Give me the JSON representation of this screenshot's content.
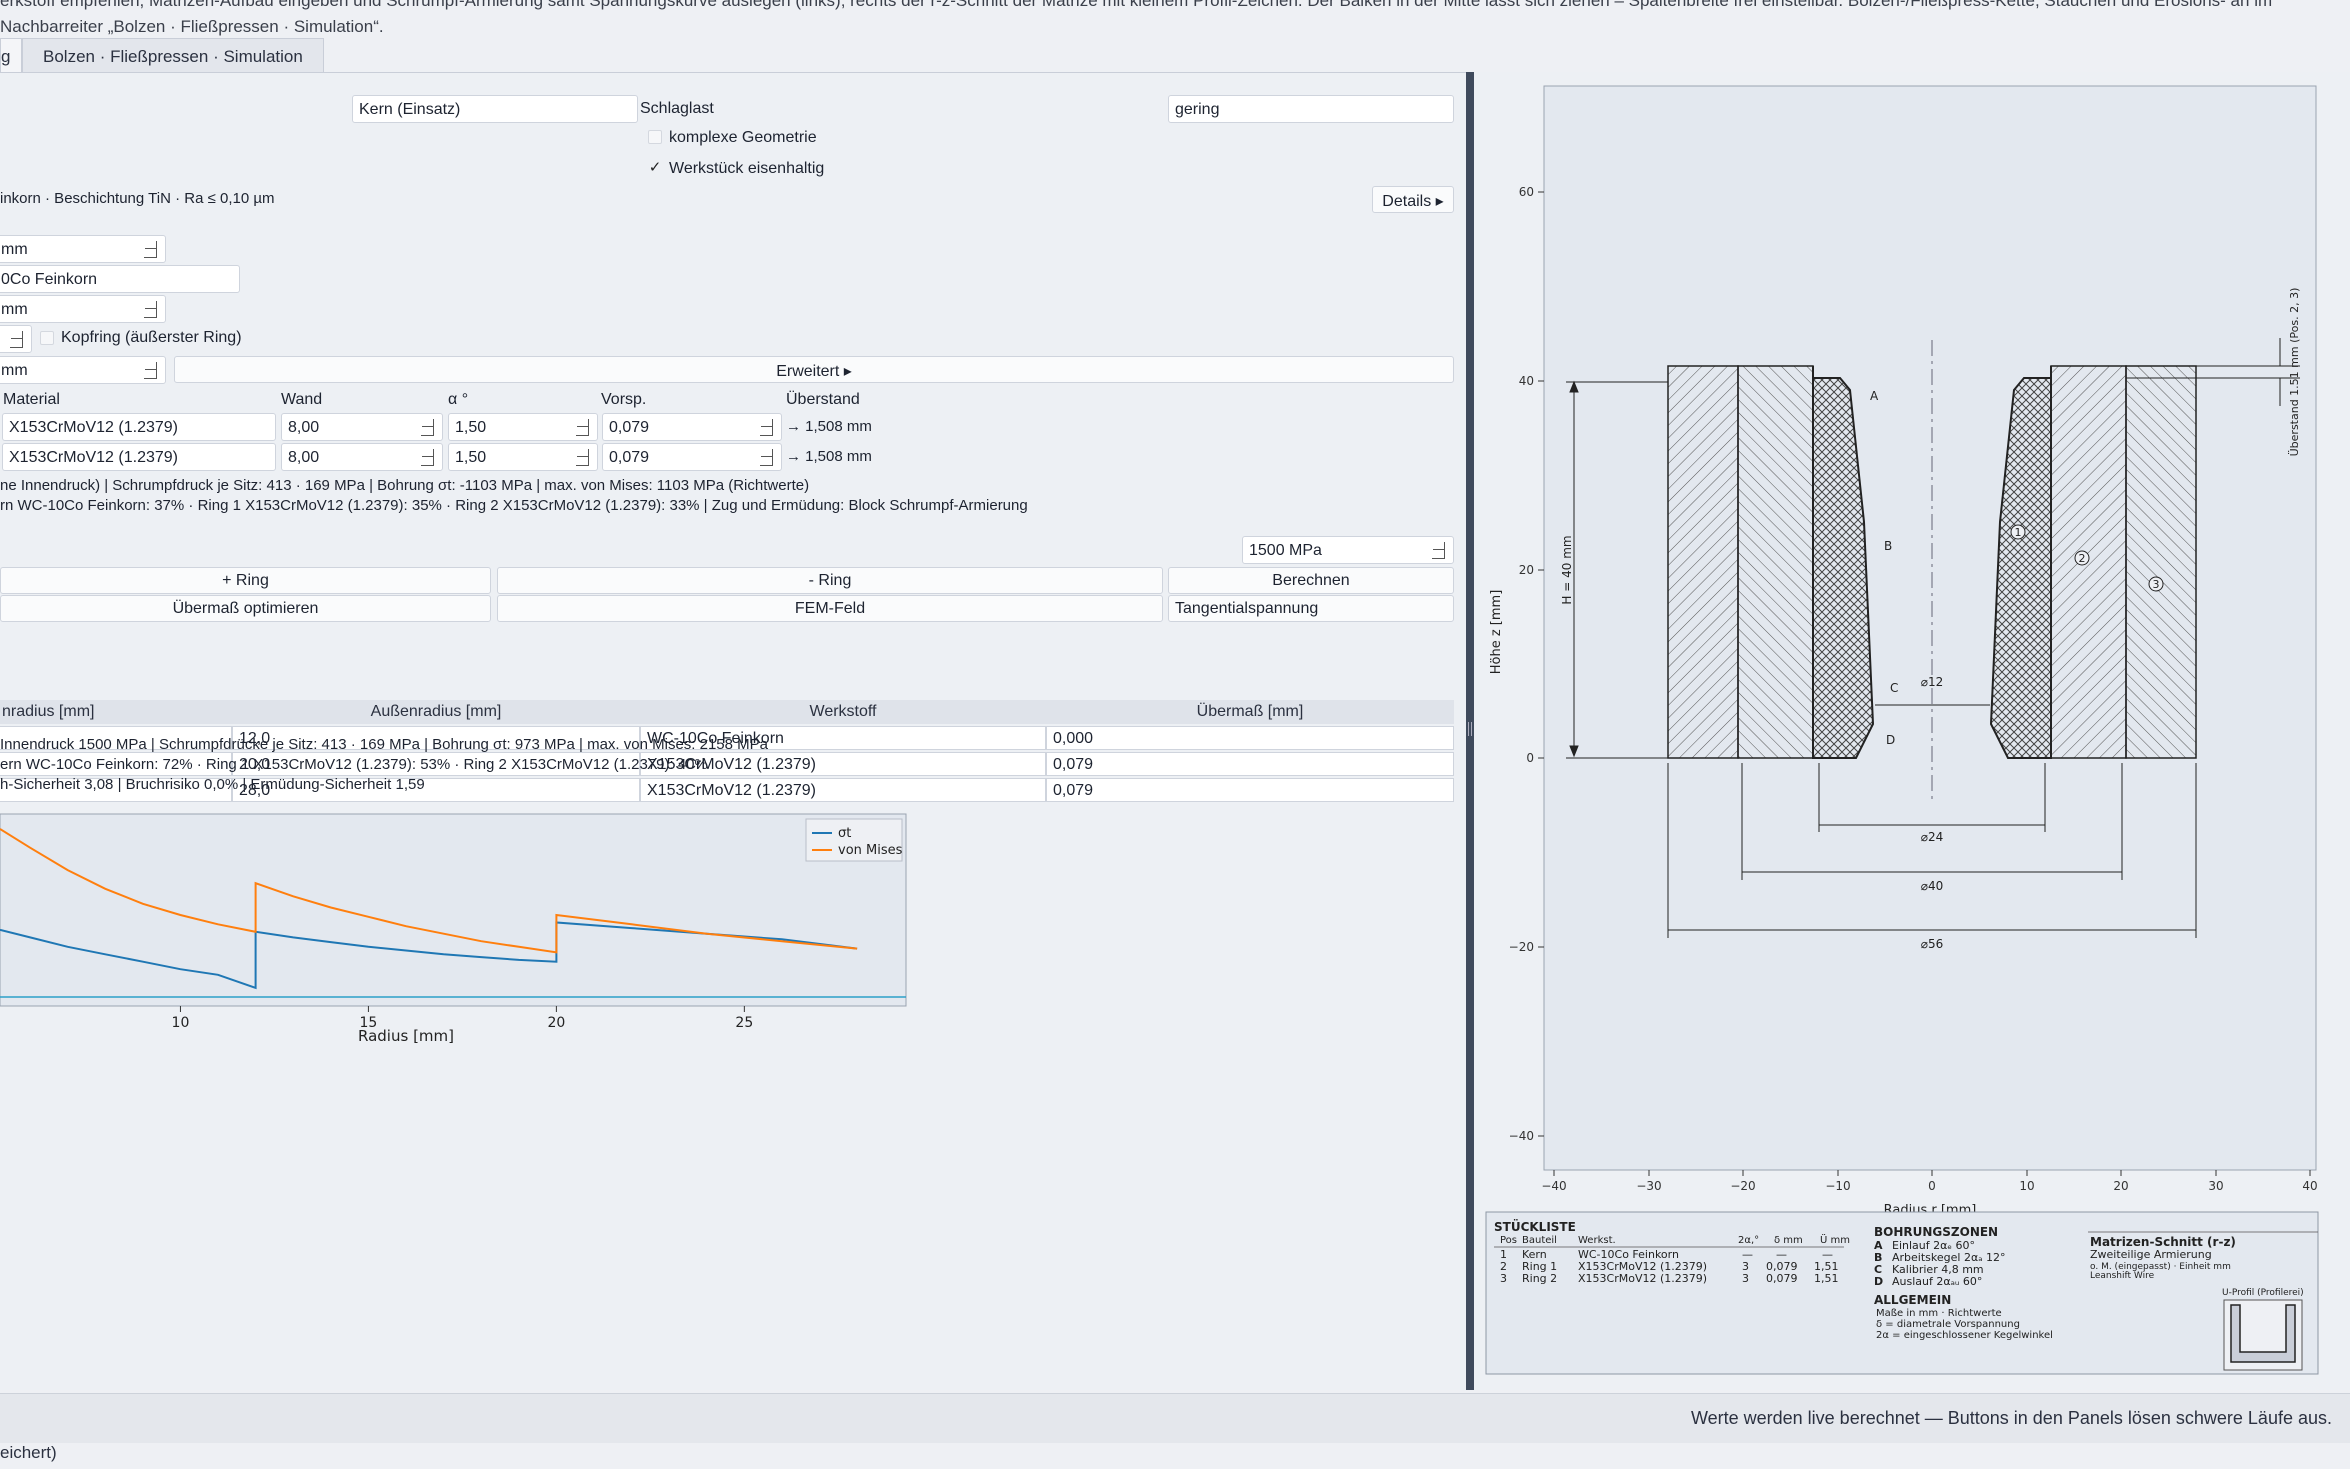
{
  "description": "erkstoff empfehlen, Matrizen-Aufbau eingeben und Schrumpf-Armierung samt Spannungskurve auslegen (links); rechts der r-z-Schnitt der Matrize mit kleinem Profil-Zeichen. Der Balken in der Mitte lässt sich ziehen – Spaltenbreite frei einstellbar. Bolzen-/Fließpress-Kette, Stauchen und Erosions- an im Nachbarreiter „Bolzen · Fließpressen · Simulation“.",
  "tabs": {
    "active": "g",
    "other": "Bolzen · Fließpressen · Simulation"
  },
  "top": {
    "part_value": "Kern (Einsatz)",
    "load_label": "Schlaglast",
    "load_value": "gering",
    "complex_label": "komplexe Geometrie",
    "ferrous_label": "Werkstück eisenhaltig",
    "check_mark": "✓",
    "recommendation": "inkorn · Beschichtung TiN · Ra ≤ 0,10 µm",
    "details_btn": "Details ▸"
  },
  "inputs": {
    "d1": "mm",
    "material": "0Co Feinkorn",
    "d2": "mm",
    "kopfring_label": "Kopfring (äußerster Ring)",
    "d3": "mm",
    "erweitert_btn": "Erweitert ▸"
  },
  "rings": {
    "headers": {
      "material": "Material",
      "wand": "Wand",
      "alpha": "α °",
      "vorsp": "Vorsp.",
      "ueberstand": "Überstand"
    },
    "rows": [
      {
        "material": "X153CrMoV12 (1.2379)",
        "wand": "8,00",
        "alpha": "1,50",
        "vorsp": "0,079",
        "ueberstand": "→ 1,508 mm"
      },
      {
        "material": "X153CrMoV12 (1.2379)",
        "wand": "8,00",
        "alpha": "1,50",
        "vorsp": "0,079",
        "ueberstand": "→ 1,508 mm"
      }
    ],
    "summary1": "ne Innendruck)  |  Schrumpfdruck je Sitz: 413 · 169 MPa  |  Bohrung σt: -1103 MPa  |  max. von Mises: 1103 MPa (Richtwerte)",
    "summary2": "rn WC-10Co Feinkorn: 37% · Ring 1 X153CrMoV12 (1.2379): 35% · Ring 2 X153CrMoV12 (1.2379): 33%  |  Zug und Ermüdung: Block Schrumpf-Armierung"
  },
  "calc": {
    "pressure": "1500 MPa",
    "buttons": [
      "+ Ring",
      "- Ring",
      "Berechnen",
      "Übermaß optimieren",
      "FEM-Feld",
      "Tangentialspannung"
    ]
  },
  "table": {
    "headers": [
      "nradius [mm]",
      "Außenradius [mm]",
      "Werkstoff",
      "Übermaß [mm]"
    ],
    "rows": [
      {
        "outer": "12,0",
        "material": "WC-10Co Feinkorn",
        "ueber": "0,000"
      },
      {
        "outer": "20,0",
        "material": "X153CrMoV12 (1.2379)",
        "ueber": "0,079"
      },
      {
        "outer": "28,0",
        "material": "X153CrMoV12 (1.2379)",
        "ueber": "0,079"
      }
    ]
  },
  "results": {
    "line1": " Innendruck 1500 MPa | Schrumpfdrücke je Sitz: 413 · 169 MPa | Bohrung σt: 973 MPa | max. von Mises: 2158 MPa",
    "line2": "ern WC-10Co Feinkorn: 72% · Ring 1 X153CrMoV12 (1.2379): 53% · Ring 2 X153CrMoV12 (1.2379): 40%",
    "line3": "h-Sicherheit 3,08 | Bruchrisiko 0,0% | Ermüdung-Sicherheit 1,59"
  },
  "chart_data": {
    "type": "line",
    "xlabel": "Radius [mm]",
    "ylabel": "",
    "xlim": [
      5.2,
      29.3
    ],
    "ylim": [
      0,
      1
    ],
    "xticks": [
      10,
      15,
      20,
      25
    ],
    "legend_position": "top-right",
    "series": [
      {
        "name": "σt",
        "color": "#1f77b4",
        "x": [
          5.2,
          6,
          7,
          8,
          9,
          10,
          11,
          12,
          12,
          13,
          14,
          15,
          16,
          17,
          18,
          19,
          20,
          20,
          22,
          24,
          26,
          28
        ],
        "y": [
          0.38,
          0.34,
          0.29,
          0.25,
          0.21,
          0.17,
          0.14,
          0.07,
          0.37,
          0.34,
          0.315,
          0.29,
          0.27,
          0.25,
          0.235,
          0.22,
          0.21,
          0.42,
          0.39,
          0.36,
          0.33,
          0.28
        ]
      },
      {
        "name": "von Mises",
        "color": "#ff7f0e",
        "x": [
          5.2,
          6,
          7,
          8,
          9,
          10,
          11,
          12,
          12,
          13,
          14,
          15,
          16,
          17,
          18,
          19,
          20,
          20,
          22,
          24,
          26,
          28
        ],
        "y": [
          0.92,
          0.82,
          0.7,
          0.6,
          0.52,
          0.46,
          0.41,
          0.37,
          0.63,
          0.56,
          0.5,
          0.45,
          0.4,
          0.36,
          0.32,
          0.29,
          0.26,
          0.46,
          0.41,
          0.36,
          0.32,
          0.28
        ]
      }
    ]
  },
  "drawing": {
    "xlabel": "Radius r [mm]",
    "ylabel": "Höhe z [mm]",
    "xticks": [
      "−40",
      "−30",
      "−20",
      "−10",
      "0",
      "10",
      "20",
      "30",
      "40"
    ],
    "yticks": [
      "60",
      "40",
      "20",
      "0",
      "−20",
      "−40"
    ],
    "height_label": "H = 40 mm",
    "overhang_label": "Überstand 1.51 mm (Pos. 2, 3)",
    "zones": [
      "A",
      "B",
      "C",
      "D"
    ],
    "positions": [
      "1",
      "2",
      "3"
    ],
    "dims": [
      "⌀12",
      "⌀24",
      "⌀40",
      "⌀56"
    ]
  },
  "bom": {
    "title": "STÜCKLISTE",
    "headers": [
      "Pos",
      "Bauteil",
      "Werkst.",
      "2α,°",
      "δ mm",
      "Ü mm"
    ],
    "rows": [
      [
        "1",
        "Kern",
        "WC-10Co Feinkorn",
        "—",
        "—",
        "—"
      ],
      [
        "2",
        "Ring 1",
        "X153CrMoV12 (1.2379)",
        "3",
        "0,079",
        "1,51"
      ],
      [
        "3",
        "Ring 2",
        "X153CrMoV12 (1.2379)",
        "3",
        "0,079",
        "1,51"
      ]
    ],
    "zones_title": "BOHRUNGSZONEN",
    "zones": [
      [
        "A",
        "Einlauf 2αₑ 60°"
      ],
      [
        "B",
        "Arbeitskegel 2αₐ 12°"
      ],
      [
        "C",
        "Kalibrier 4,8 mm"
      ],
      [
        "D",
        "Auslauf 2αₐᵤ 60°"
      ]
    ],
    "general_title": "ALLGEMEIN",
    "general": [
      "Maße in mm · Richtwerte",
      "δ = diametrale Vorspannung",
      "2α = eingeschlossener Kegelwinkel"
    ],
    "block_title": "Matrizen-Schnitt (r-z)",
    "block_sub": "Zweiteilige Armierung",
    "block_note1": "o. M. (eingepasst) · Einheit mm",
    "block_note2": "Leanshift Wire",
    "profile_label": "U-Profil (Profilerei)"
  },
  "status": {
    "right": "Werte werden live berechnet — Buttons in den Panels lösen schwere Läufe aus.",
    "bottom_left": "eichert)"
  }
}
